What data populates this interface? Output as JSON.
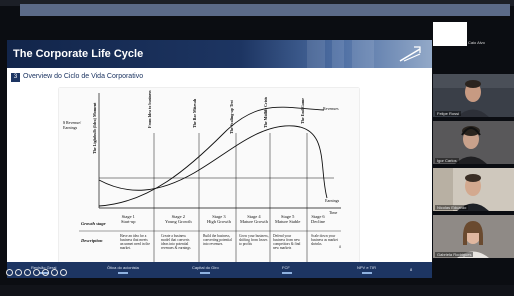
{
  "slide": {
    "title": "The Corporate Life Cycle",
    "section_number": "3",
    "section_title": "Overview do Ciclo de Vida Corporativo",
    "page_number": "8"
  },
  "chart": {
    "y_axis_label": "$ Revenue/ Earnings",
    "curve_revenues": "Revenues",
    "curve_earnings": "Earnings",
    "x_axis_label": "Time",
    "milestones": [
      "The Lightbulb (Idea) Moment",
      "From Idea to business",
      "The Bar Mitzvah",
      "The Scaling-up Test",
      "The Midlife Crisis",
      "The End Game"
    ],
    "row_growth_stage": "Growth stage",
    "row_description": "Description",
    "stages": [
      {
        "name": "Stage 1",
        "label": "Start-up",
        "desc": "Have an idea for a business that meets an unmet need in the market."
      },
      {
        "name": "Stage 2",
        "label": "Young Growth",
        "desc": "Create a business model that converts ideas into potential revenues & earnings"
      },
      {
        "name": "Stage 3",
        "label": "High Growth",
        "desc": "Build the business, converting potential into revenues."
      },
      {
        "name": "Stage 4",
        "label": "Mature Growth",
        "desc": "Grow your business, shifting from losses to profits"
      },
      {
        "name": "Stage 5",
        "label": "Mature Stable",
        "desc": "Defend your business from new competitors & find new markets"
      },
      {
        "name": "Stage 6",
        "label": "Decline",
        "desc": "Scale down your business as market shrinks."
      }
    ]
  },
  "footer": {
    "items": [
      "Revisão Geral",
      "Ótica do acionista",
      "Capital do Giro",
      "FCF",
      "NPV e TIR"
    ]
  },
  "participants": [
    {
      "name": "Caio Alvo"
    },
    {
      "name": "Felipe Rossi"
    },
    {
      "name": "Igor Carlos"
    },
    {
      "name": "Nicolas Eduardo"
    },
    {
      "name": "Gabriela Rodrigues"
    }
  ],
  "colors": {
    "slide_header": "#1d3562",
    "footer": "#1d3562",
    "background": "#0b0d12"
  }
}
